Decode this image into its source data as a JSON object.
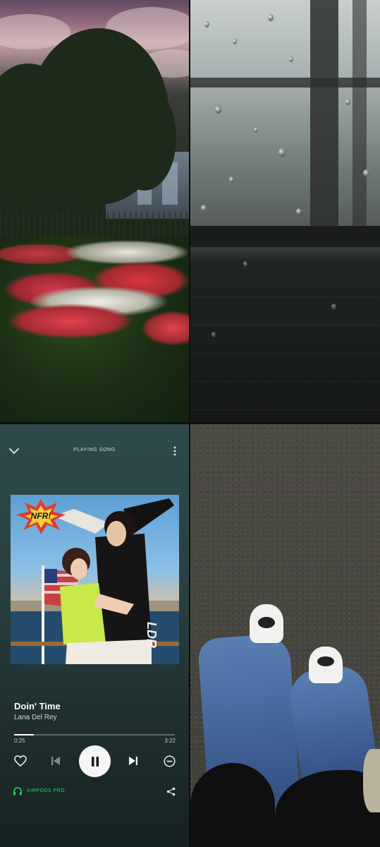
{
  "player": {
    "header_title": "PLAYING SONG",
    "icons": {
      "collapse": "chevron-down-icon",
      "more": "more-vertical-icon",
      "like": "heart-icon",
      "previous": "skip-previous-icon",
      "play_pause": "pause-icon",
      "next": "skip-next-icon",
      "hide": "minus-circle-icon",
      "device": "headphones-icon",
      "share": "share-icon"
    },
    "album_art": {
      "badge_text": "NFR!",
      "side_text": "LDR"
    },
    "song": {
      "title": "Doin' Time",
      "artist": "Lana Del Rey"
    },
    "progress": {
      "elapsed": "0:25",
      "duration": "3:22",
      "fraction": 0.124
    },
    "device_label": "AIRPODS PRO",
    "colors": {
      "accent": "#1ed760",
      "background_top": "#2f4a4c",
      "background_bottom": "#162221"
    }
  }
}
